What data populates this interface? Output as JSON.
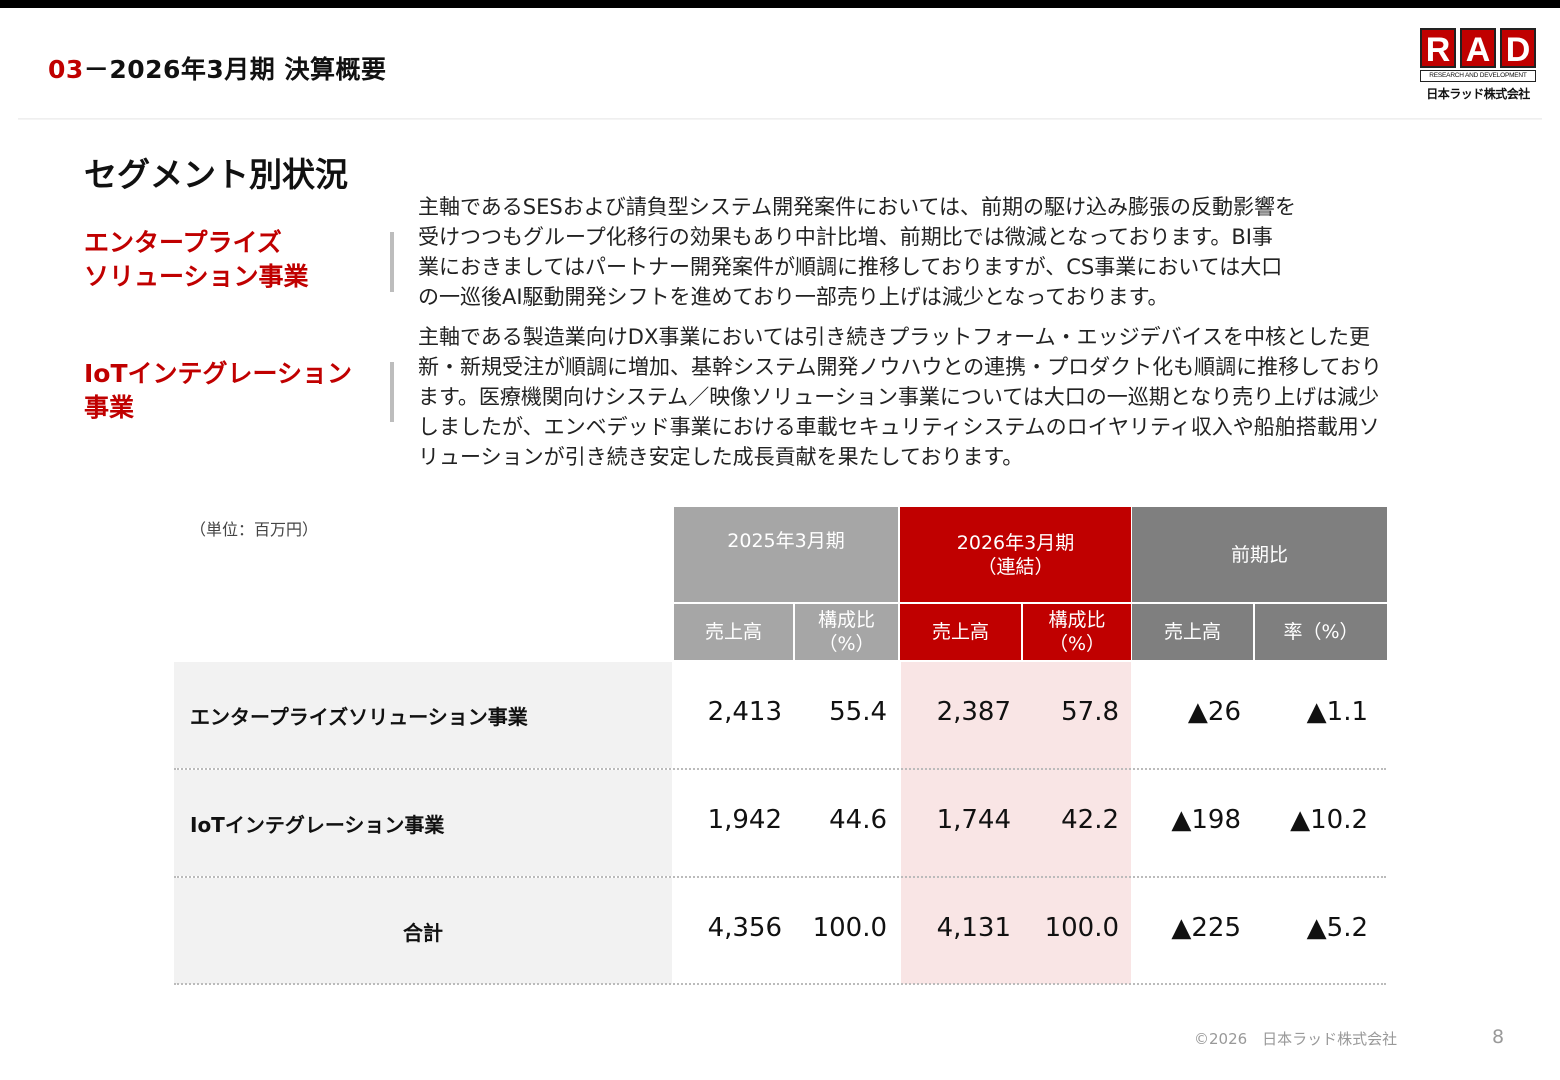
{
  "header": {
    "number": "03",
    "dash": "－",
    "title": "2026年3月期 決算概要"
  },
  "logo": {
    "letters": [
      "R",
      "A",
      "D"
    ],
    "tagline": "RESEARCH AND DEVELOPMENT",
    "company": "日本ラッド株式会社"
  },
  "section_title": "セグメント別状況",
  "segments": [
    {
      "label_lines": [
        "エンタープライズ",
        "ソリューション事業"
      ],
      "text_lines": [
        "主軸であるSESおよび請負型システム開発案件においては、前期の駆け込み膨張の反動影響を",
        "受けつつもグループ化移行の効果もあり中計比増、前期比では微減となっております。BI事",
        "業におきましてはパートナー開発案件が順調に推移しておりますが、CS事業においては大口",
        "の一巡後AI駆動開発シフトを進めており一部売り上げは減少となっております。"
      ]
    },
    {
      "label_lines": [
        "IoTインテグレーション",
        "事業"
      ],
      "text_lines": [
        "主軸である製造業向けDX事業においては引き続きプラットフォーム・エッジデバイスを中核とした更",
        "新・新規受注が順調に増加、基幹システム開発ノウハウとの連携・プロダクト化も順調に推移しており",
        "ます。医療機関向けシステム／映像ソリューション事業については大口の一巡期となり売り上げは減少",
        "しましたが、エンベデッド事業における車載セキュリティシステムのロイヤリティ収入や船舶搭載用ソ",
        "リューションが引き続き安定した成長貢献を果たしております。"
      ]
    }
  ],
  "table": {
    "unit": "（単位：百万円）",
    "groups": [
      {
        "lines": [
          "2025年3月期"
        ]
      },
      {
        "lines": [
          "2026年3月期",
          "（連結）"
        ]
      },
      {
        "lines": [
          "前期比"
        ]
      }
    ],
    "subheaders": [
      {
        "lines": [
          "売上高"
        ]
      },
      {
        "lines": [
          "構成比",
          "（%）"
        ]
      },
      {
        "lines": [
          "売上高"
        ]
      },
      {
        "lines": [
          "構成比",
          "（%）"
        ]
      },
      {
        "lines": [
          "売上高"
        ]
      },
      {
        "lines": [
          "率（%）"
        ]
      }
    ],
    "rows": [
      {
        "name": "エンタープライズソリューション事業",
        "values": [
          "2,413",
          "55.4",
          "2,387",
          "57.8",
          "▲26",
          "▲1.1"
        ]
      },
      {
        "name": "IoTインテグレーション事業",
        "values": [
          "1,942",
          "44.6",
          "1,744",
          "42.2",
          "▲198",
          "▲10.2"
        ]
      },
      {
        "name": "合計",
        "values": [
          "4,356",
          "100.0",
          "4,131",
          "100.0",
          "▲225",
          "▲5.2"
        ]
      }
    ]
  },
  "footer": {
    "copyright": "©2026　日本ラッド株式会社",
    "page": "8"
  }
}
